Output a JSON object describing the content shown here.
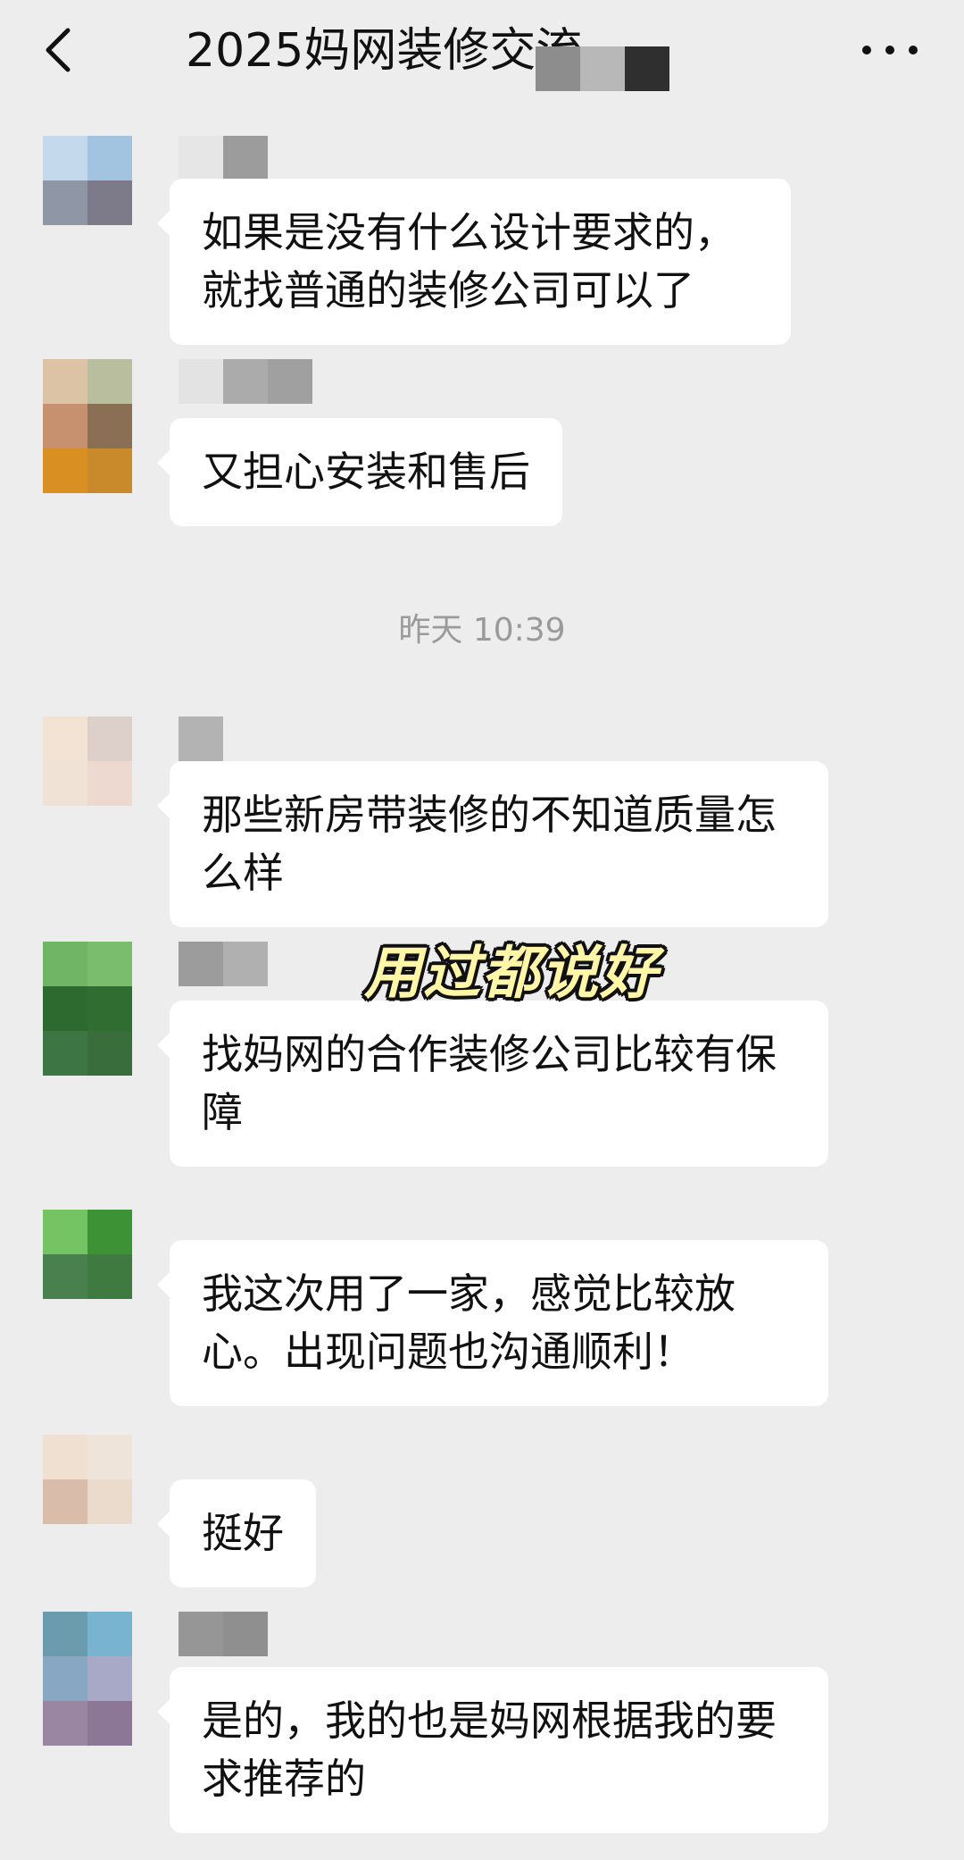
{
  "header": {
    "title": "2025妈网装修交流",
    "back_icon": "chevron-left-icon",
    "more_icon": "ellipsis-icon"
  },
  "timestamp": "昨天 10:39",
  "overlay_text": "用过都说好",
  "messages": [
    {
      "text": "如果是没有什么设计要求的，就找普通的装修公司可以了"
    },
    {
      "text": "又担心安装和售后"
    },
    {
      "text": "那些新房带装修的不知道质量怎么样"
    },
    {
      "text": "找妈网的合作装修公司比较有保障"
    },
    {
      "text": "我这次用了一家，感觉比较放心。出现问题也沟通顺利！"
    },
    {
      "text": "挺好"
    },
    {
      "text": "是的，我的也是妈网根据我的要求推荐的"
    }
  ]
}
